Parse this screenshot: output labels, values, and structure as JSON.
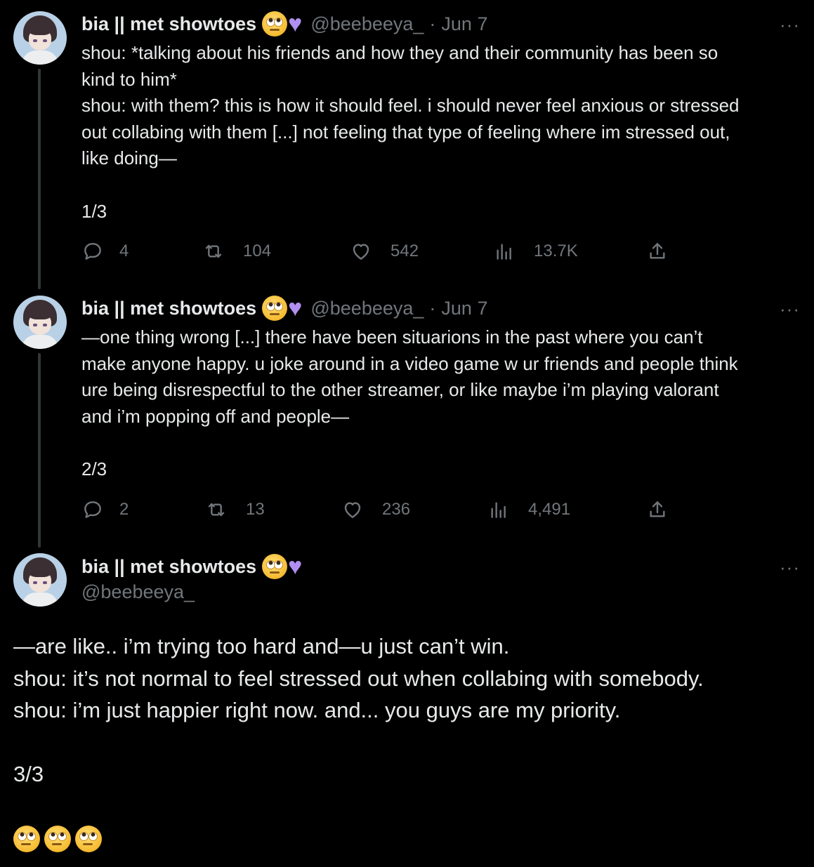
{
  "tweets": [
    {
      "display_name": "bia || met showtoes",
      "name_emojis": [
        "face-with-rolling-eyes",
        "purple-heart"
      ],
      "handle": "@beebeeya_",
      "separator": "·",
      "date": "Jun 7",
      "more": "···",
      "lines": [
        "shou: *talking about his friends and how they and their community has been so",
        "kind to him*",
        "shou: with them? this is how it should feel. i should never feel anxious or stressed",
        "out collabing with them [...] not feeling that type of feeling where im stressed out,",
        "like doing—",
        "",
        "1/3"
      ],
      "replies": "4",
      "reposts": "104",
      "likes": "542",
      "views": "13.7K"
    },
    {
      "display_name": "bia || met showtoes",
      "name_emojis": [
        "face-with-rolling-eyes",
        "purple-heart"
      ],
      "handle": "@beebeeya_",
      "separator": "·",
      "date": "Jun 7",
      "more": "···",
      "lines": [
        "—one thing wrong [...] there have been situarions in the past where you can’t",
        "make anyone happy. u joke around in a video game w ur friends and people think",
        "ure being disrespectful to the other streamer, or like maybe i’m playing valorant",
        "and i’m popping off and people—",
        "",
        "2/3"
      ],
      "replies": "2",
      "reposts": "13",
      "likes": "236",
      "views": "4,491"
    }
  ],
  "main_tweet": {
    "display_name": "bia || met showtoes",
    "name_emojis": [
      "face-with-rolling-eyes",
      "purple-heart"
    ],
    "handle": "@beebeeya_",
    "more": "···",
    "lines": [
      "—are like.. i’m trying too hard and—u just can’t win.",
      "shou: it’s not normal to feel stressed out when collabing with somebody.",
      "shou: i’m just happier right now. and... you guys are my priority.",
      "",
      "3/3"
    ],
    "trailing_emojis": [
      "face-with-rolling-eyes",
      "face-with-rolling-eyes",
      "face-with-rolling-eyes"
    ]
  },
  "colors": {
    "background": "#000000",
    "text": "#e7e9ea",
    "secondary": "#71767b",
    "thread_line": "#333639",
    "heart": "#b18ff0"
  }
}
